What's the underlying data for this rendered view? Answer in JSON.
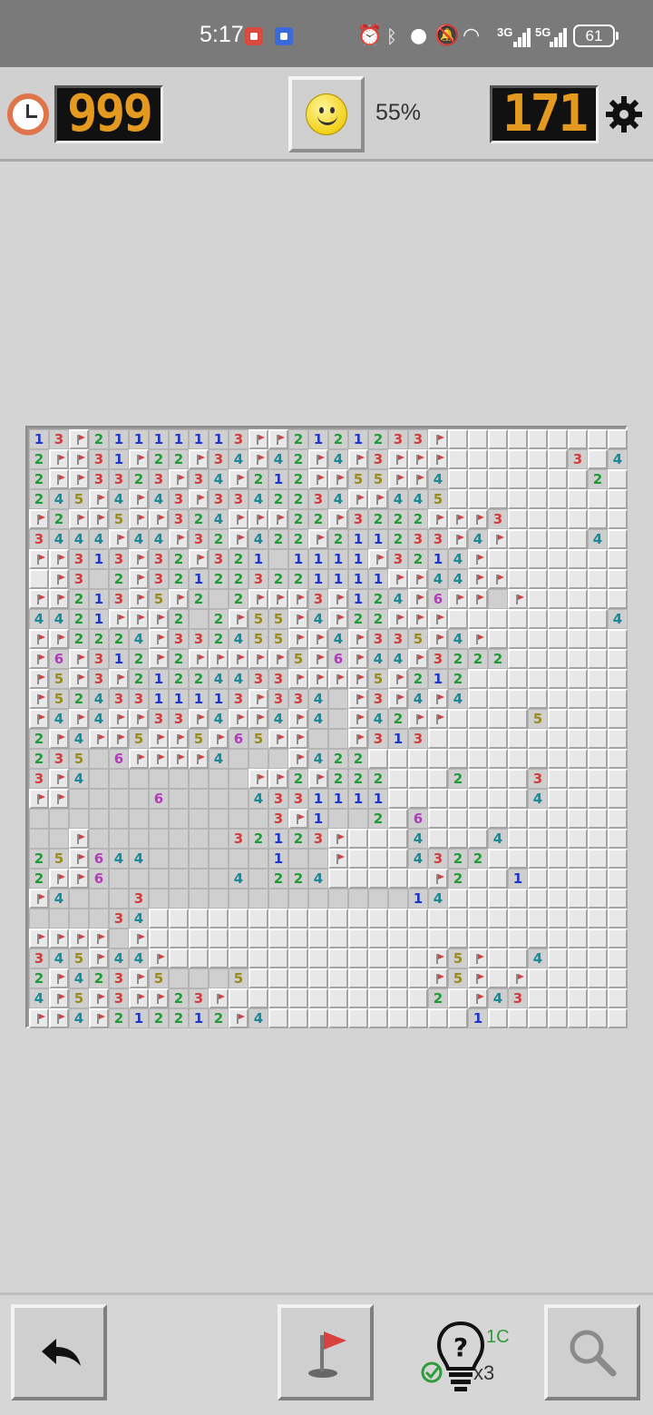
{
  "status_bar": {
    "time": "5:17",
    "battery": "61",
    "net1": "3G",
    "net2": "5G"
  },
  "game": {
    "timer": "999",
    "mines_remaining": "171",
    "progress": "55%"
  },
  "hint": {
    "count": "1C",
    "multiplier": "x3"
  },
  "icons": {
    "clock": "clock-icon",
    "smiley": "smiley-face-icon",
    "settings": "gear-icon",
    "undo": "undo-arrow-icon",
    "flag": "flag-icon",
    "hint": "lightbulb-question-icon",
    "search": "magnifier-icon"
  },
  "colors": {
    "counter_digits": "#e39a1e",
    "counter_bg": "#111111",
    "flag": "#d44141"
  },
  "board": {
    "cols": 30,
    "rows": [
      "13F21111113FF2121233F.........",
      "2FF31F22F34F42F4F3FFF......3.4",
      "2FF3323F34F212FF55FF4.......2.",
      "245F4F43F3342234FF445........",
      "F2FF5FF324FFF22F3222FFF3.....",
      "3444F44F32F422F211233F4F....4.",
      "FF313F32F321 1111F3214F.......",
      ".F3 2F321223221111FF44FF.......",
      "FF213F5F2 2FFF3F124F6FF F.....",
      "4421FFF2 2F55F4F22FFF........4.",
      "FF2224F332455FF4F335F4F.......",
      "F6F312F2FFFFF5F6F44F3222......",
      "F5F3F21224433FFFF5F212.......",
      "F5243311113F334 F3F4F4.......",
      "F4F4FF33F4FF4F4 F42FF....5...",
      "2F4FF5FF5F65FF  F313........",
      "235 6FFFF4   F422.........",
      "3F4        FF2F222...2...3.",
      "FF    6    4331111.......4.",
      "            3F1  2.6.......",
      "  F       32123F...4...4.",
      "25F644      1  F...4322.",
      "2FF6      4 224.....F2..1.",
      "F4   3             14......",
      "    34....................",
      "FFFF F....................",
      "345F44F.............F5F..4",
      "2F423F5   5.........F5F.F.",
      "4F5F3FF23F..........2.F43..",
      "FF4F212212F4..........1....."
    ]
  }
}
